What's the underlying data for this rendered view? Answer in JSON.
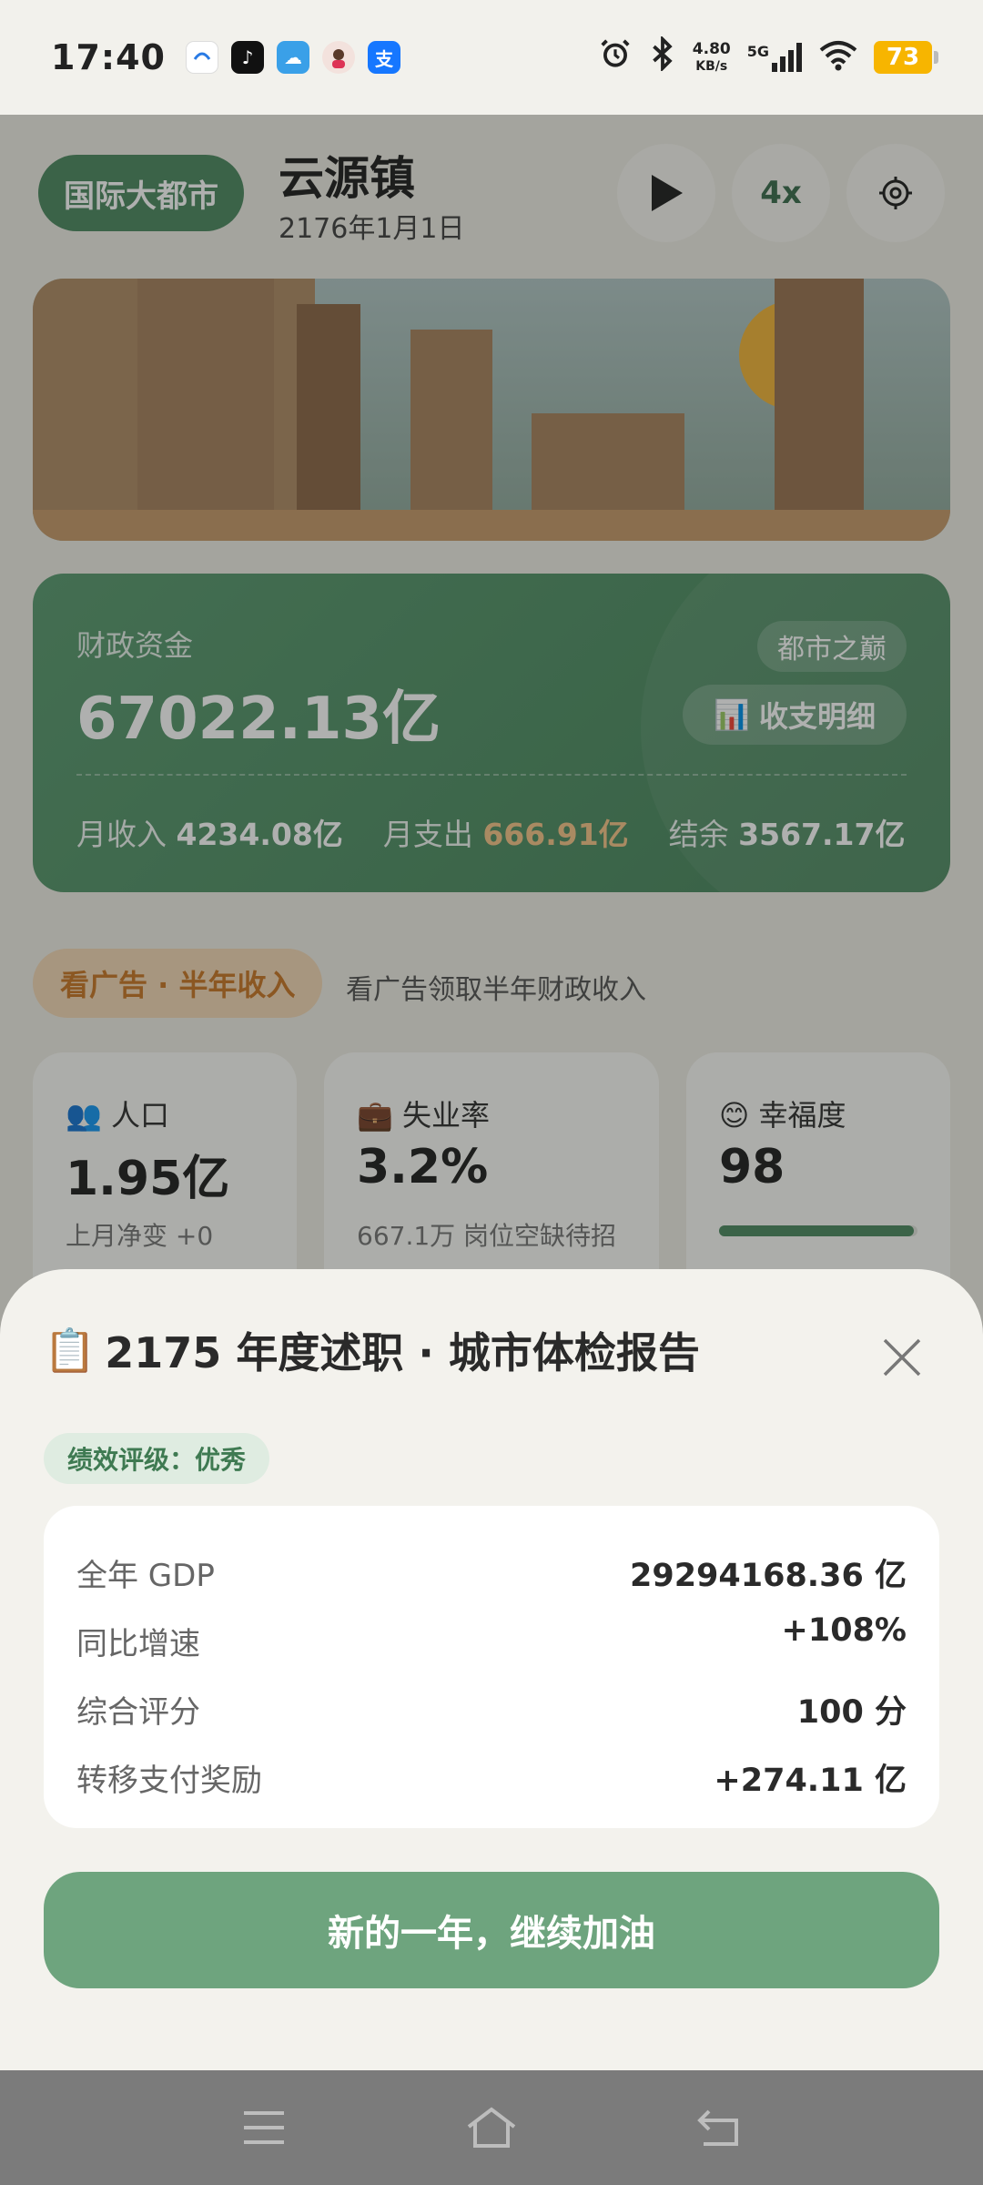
{
  "status_bar": {
    "time": "17:40",
    "net_speed_value": "4.80",
    "net_speed_unit": "KB/s",
    "network": "5G",
    "battery": "73",
    "app_icons": [
      "browser-icon",
      "tiktok-icon",
      "cloud-icon",
      "avatar-icon",
      "alipay-icon"
    ]
  },
  "header": {
    "tier": "国际大都市",
    "town_name": "云源镇",
    "date": "2176年1月1日",
    "speed": "4x"
  },
  "fiscal": {
    "label": "财政资金",
    "amount": "67022.13亿",
    "badge": "都市之巅",
    "detail_button": "收支明细",
    "income_label": "月收入",
    "income_value": "4234.08亿",
    "expense_label": "月支出",
    "expense_value": "666.91亿",
    "balance_label": "结余",
    "balance_value": "3567.17亿"
  },
  "ad": {
    "button": "看广告 · 半年收入",
    "description": "看广告领取半年财政收入"
  },
  "stats": {
    "population": {
      "title": "人口",
      "value": "1.95亿",
      "sub": "上月净变 +0",
      "fill": 1.0
    },
    "unemployment": {
      "title": "失业率",
      "value": "3.2%",
      "sub": "667.1万 岗位空缺待招",
      "fill": 0.032
    },
    "happiness": {
      "title": "幸福度",
      "value": "98",
      "fill": 0.98
    }
  },
  "sheet": {
    "title": "2175 年度述职 · 城市体检报告",
    "rating": "绩效评级：优秀",
    "rows": [
      {
        "key": "全年 GDP",
        "value": "29294168.36 亿"
      },
      {
        "key": "同比增速",
        "value": "+108%"
      },
      {
        "key": "综合评分",
        "value": "100 分"
      },
      {
        "key": "转移支付奖励",
        "value": "+274.11 亿"
      }
    ],
    "continue_button": "新的一年，继续加油"
  },
  "colors": {
    "accent_green": "#4f8a63",
    "button_green": "#6ea47e",
    "expense_orange": "#f6c58b",
    "ad_orange": "#c9782a"
  }
}
